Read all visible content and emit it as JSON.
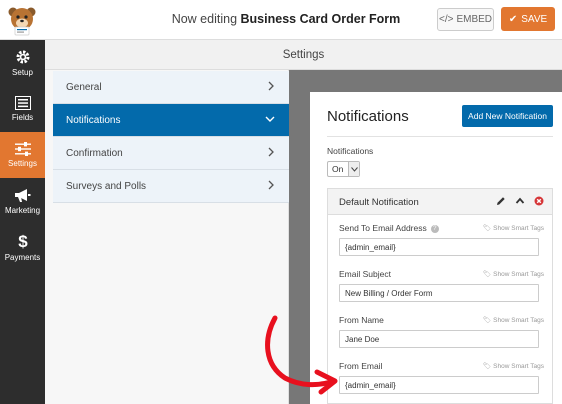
{
  "header": {
    "prefix": "Now editing",
    "form_name": "Business Card Order Form",
    "embed_label": "EMBED",
    "save_label": "SAVE"
  },
  "sidebar": {
    "items": [
      {
        "label": "Setup",
        "icon": "gear-icon"
      },
      {
        "label": "Fields",
        "icon": "fields-list-icon"
      },
      {
        "label": "Settings",
        "icon": "sliders-icon",
        "active": true
      },
      {
        "label": "Marketing",
        "icon": "megaphone-icon"
      },
      {
        "label": "Payments",
        "icon": "dollar-icon"
      }
    ]
  },
  "settings": {
    "title": "Settings",
    "menu": [
      {
        "label": "General"
      },
      {
        "label": "Notifications",
        "active": true
      },
      {
        "label": "Confirmation"
      },
      {
        "label": "Surveys and Polls"
      }
    ]
  },
  "notifications": {
    "title": "Notifications",
    "add_button": "Add New Notification",
    "toggle_label": "Notifications",
    "toggle_value": "On",
    "default_title": "Default Notification",
    "smart_tags": "Show Smart Tags",
    "fields": [
      {
        "label": "Send To Email Address",
        "value": "{admin_email}"
      },
      {
        "label": "Email Subject",
        "value": "New Billing / Order Form"
      },
      {
        "label": "From Name",
        "value": "Jane Doe"
      },
      {
        "label": "From Email",
        "value": "{admin_email}"
      }
    ]
  },
  "colors": {
    "accent_orange": "#e27730",
    "accent_blue": "#036aab",
    "sidebar_dark": "#2d2d2d",
    "annotation_red": "#e8101e"
  }
}
